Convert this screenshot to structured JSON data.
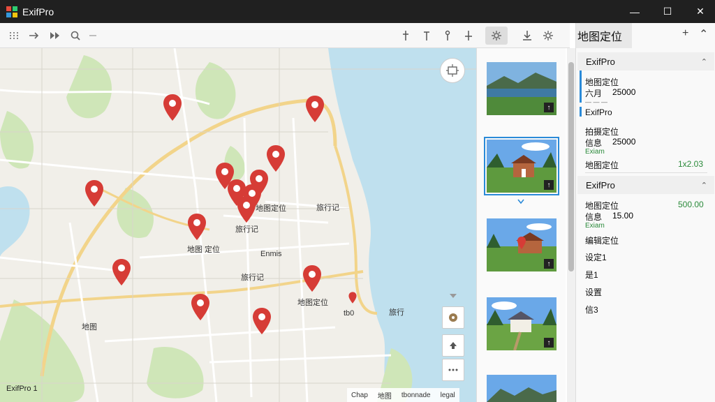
{
  "window": {
    "title": "ExifPro",
    "minimize": "—",
    "maximize": "☐",
    "close": "✕"
  },
  "toolbar": {
    "icons": [
      "grid-icon",
      "forward-icon",
      "play-icon",
      "zoom-icon",
      "more-icon",
      "pin-icon",
      "align-icon",
      "marker-icon",
      "flag-icon",
      "settings-icon",
      "download-icon",
      "gear-icon"
    ]
  },
  "map": {
    "labels": [
      {
        "text": "地图定位",
        "pos": "label-1"
      },
      {
        "text": "旅行记",
        "pos": "label-2"
      },
      {
        "text": "Enmis",
        "pos": "label-3"
      },
      {
        "text": "地图 定位",
        "pos": "label-4"
      },
      {
        "text": "旅行记",
        "pos": "label-5"
      },
      {
        "text": "地图定位",
        "pos": "label-6"
      },
      {
        "text": "旅行记",
        "pos": "label-7"
      },
      {
        "text": "地图",
        "pos": "label-8"
      },
      {
        "text": "tb0",
        "pos": "label-9"
      },
      {
        "text": "旅行",
        "pos": "label-10"
      }
    ],
    "footer": "ExifPro 1",
    "attribution": [
      "Chap",
      "地图",
      "tbonnade",
      "legal"
    ]
  },
  "panel": {
    "title": "地图定位",
    "add": "+",
    "collapse": "⌃",
    "sections": [
      {
        "name": "ExifPro",
        "rows": [
          {
            "label": "地图定位",
            "value": ""
          },
          {
            "label": "六月",
            "value": "25000"
          }
        ]
      },
      {
        "name": "ExifPro",
        "rows": [
          {
            "label": "拍摄定位",
            "value": ""
          },
          {
            "label": "信息",
            "value": "25000"
          },
          {
            "label": "Exiam",
            "value": ""
          },
          {
            "label": "地图定位",
            "value": "1x2.03"
          }
        ]
      },
      {
        "name": "ExifPro",
        "rows": [
          {
            "label": "地图定位",
            "value": "500.00"
          },
          {
            "label": "信息",
            "value": "15.00"
          },
          {
            "label": "Exiam",
            "value": ""
          },
          {
            "label": "编辑定位",
            "value": ""
          },
          {
            "label": "设定1",
            "value": ""
          },
          {
            "label": "是1",
            "value": ""
          },
          {
            "label": "设置",
            "value": ""
          },
          {
            "label": "信3",
            "value": ""
          }
        ]
      }
    ]
  },
  "colors": {
    "pin": "#d63c36",
    "water": "#bfe0ee",
    "road": "#f2d48a",
    "park": "#cfe6b8",
    "accent": "#2a8ad8"
  }
}
